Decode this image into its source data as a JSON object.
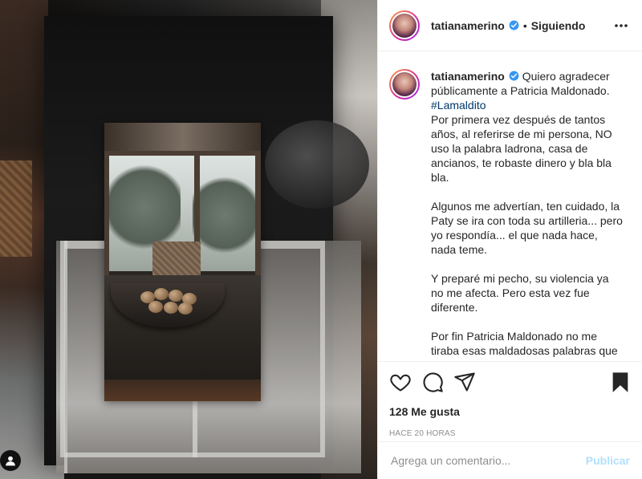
{
  "post": {
    "username": "tatianamerino",
    "verified": true,
    "follow_separator": "•",
    "follow_status": "Siguiendo",
    "more_icon": "more-horizontal-icon",
    "user_badge_icon": "person-icon"
  },
  "caption": {
    "username": "tatianamerino",
    "intro": "Quiero agradecer públicamente a Patricia Maldonado.",
    "hashtag": "#Lamaldito",
    "paragraphs": [
      "Por primera vez después de tantos años, al referirse de mi persona, NO uso la palabra ladrona, casa de ancianos, te robaste dinero y bla bla bla.",
      "Algunos me advertían, ten cuidado, la Paty se ira con toda su artilleria... pero yo respondía... el que nada hace, nada teme.",
      "Y preparé mi pecho, su violencia ya no me afecta. Pero esta vez fue diferente.",
      "Por fin Patricia Maldonado no me tiraba esas maldadosas palabras que"
    ]
  },
  "actions": {
    "like_icon": "heart-icon",
    "comment_icon": "comment-icon",
    "share_icon": "paper-plane-icon",
    "save_icon": "bookmark-icon",
    "likes": "128 Me gusta",
    "time_ago": "HACE 20 HORAS"
  },
  "comment_box": {
    "placeholder": "Agrega un comentario...",
    "publish_label": "Publicar"
  },
  "colors": {
    "verified_blue": "#3897f0",
    "hashtag": "#00376b",
    "publish_disabled": "#b2dffc",
    "muted": "#8e8e8e"
  }
}
